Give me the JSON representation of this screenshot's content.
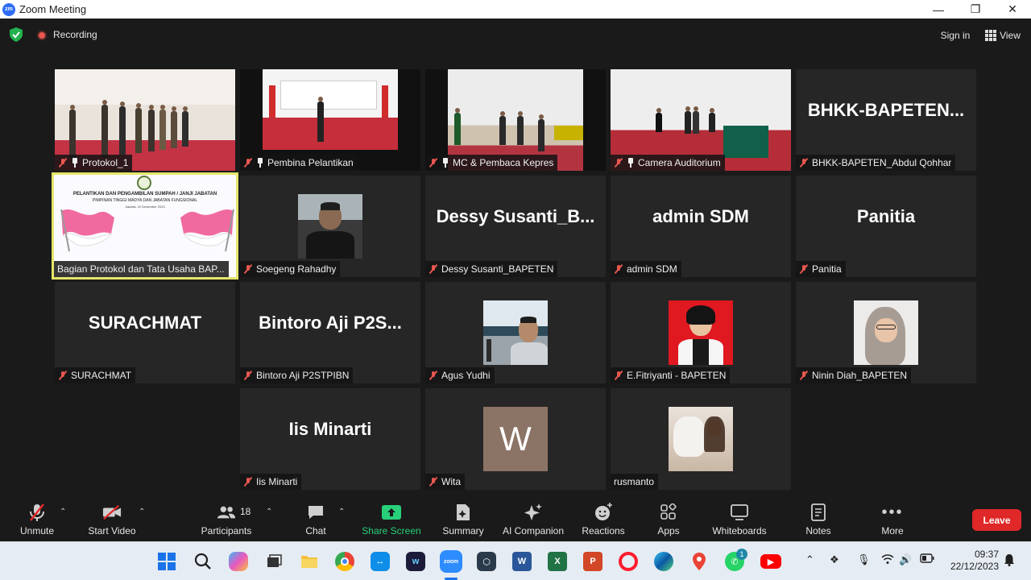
{
  "window": {
    "title": "Zoom Meeting",
    "app_icon_text": "zm"
  },
  "topbar": {
    "recording_label": "Recording",
    "signin_label": "Sign in",
    "view_label": "View"
  },
  "tiles": [
    {
      "name": "Protokol_1",
      "big": ""
    },
    {
      "name": "Pembina Pelantikan",
      "big": ""
    },
    {
      "name": "MC & Pembaca Kepres",
      "big": ""
    },
    {
      "name": "Camera Auditorium",
      "big": ""
    },
    {
      "name": "BHKK-BAPETEN_Abdul Qohhar",
      "big": "BHKK-BAPETEN..."
    },
    {
      "name": "Bagian Protokol dan Tata Usaha BAP...",
      "big": ""
    },
    {
      "name": "Soegeng Rahadhy",
      "big": ""
    },
    {
      "name": "Dessy Susanti_BAPETEN",
      "big": "Dessy  Susanti_B..."
    },
    {
      "name": "admin SDM",
      "big": "admin SDM"
    },
    {
      "name": "Panitia",
      "big": "Panitia"
    },
    {
      "name": "SURACHMAT",
      "big": "SURACHMAT"
    },
    {
      "name": "Bintoro Aji P2STPIBN",
      "big": "Bintoro  Aji  P2S..."
    },
    {
      "name": "Agus Yudhi",
      "big": ""
    },
    {
      "name": "E.Fitriyanti - BAPETEN",
      "big": ""
    },
    {
      "name": "Ninin Diah_BAPETEN",
      "big": ""
    },
    {
      "name": "Iis Minarti",
      "big": "Iis Minarti"
    },
    {
      "name": "Wita",
      "big": ""
    },
    {
      "name": "rusmanto",
      "big": ""
    }
  ],
  "avatar_letters": {
    "wita": "W"
  },
  "slide": {
    "line1": "PELANTIKAN DAN PENGAMBILAN SUMPAH / JANJI JABATAN",
    "line2": "PIMPINAN TINGGI MADYA DAN JABATAN FUNGSIONAL",
    "line3": "Jakarta, 22 Desember 2023"
  },
  "toolbar": {
    "unmute": "Unmute",
    "start_video": "Start Video",
    "participants": "Participants",
    "participants_count": "18",
    "chat": "Chat",
    "share_screen": "Share Screen",
    "summary": "Summary",
    "ai_companion": "AI Companion",
    "reactions": "Reactions",
    "apps": "Apps",
    "whiteboards": "Whiteboards",
    "notes": "Notes",
    "more": "More",
    "leave": "Leave"
  },
  "taskbar": {
    "time": "09:37",
    "date": "22/12/2023",
    "whatsapp_badge": "1",
    "zoom_label": "zoom"
  },
  "colors": {
    "accent_green": "#28d07a",
    "leave_red": "#e02828",
    "muted_red": "#e8574f",
    "active_speaker": "#e5e56b"
  }
}
